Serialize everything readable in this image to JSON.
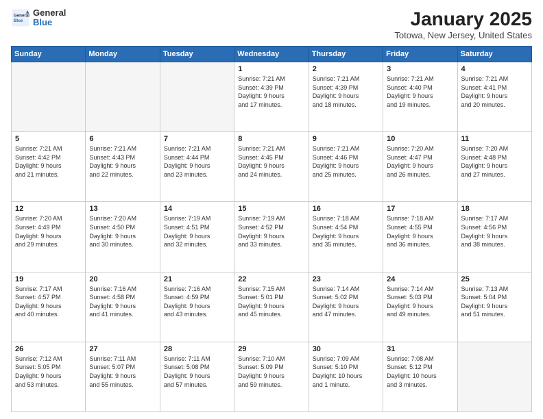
{
  "header": {
    "logo_general": "General",
    "logo_blue": "Blue",
    "month_title": "January 2025",
    "location": "Totowa, New Jersey, United States"
  },
  "days_of_week": [
    "Sunday",
    "Monday",
    "Tuesday",
    "Wednesday",
    "Thursday",
    "Friday",
    "Saturday"
  ],
  "weeks": [
    [
      {
        "day": "",
        "content": ""
      },
      {
        "day": "",
        "content": ""
      },
      {
        "day": "",
        "content": ""
      },
      {
        "day": "1",
        "content": "Sunrise: 7:21 AM\nSunset: 4:39 PM\nDaylight: 9 hours\nand 17 minutes."
      },
      {
        "day": "2",
        "content": "Sunrise: 7:21 AM\nSunset: 4:39 PM\nDaylight: 9 hours\nand 18 minutes."
      },
      {
        "day": "3",
        "content": "Sunrise: 7:21 AM\nSunset: 4:40 PM\nDaylight: 9 hours\nand 19 minutes."
      },
      {
        "day": "4",
        "content": "Sunrise: 7:21 AM\nSunset: 4:41 PM\nDaylight: 9 hours\nand 20 minutes."
      }
    ],
    [
      {
        "day": "5",
        "content": "Sunrise: 7:21 AM\nSunset: 4:42 PM\nDaylight: 9 hours\nand 21 minutes."
      },
      {
        "day": "6",
        "content": "Sunrise: 7:21 AM\nSunset: 4:43 PM\nDaylight: 9 hours\nand 22 minutes."
      },
      {
        "day": "7",
        "content": "Sunrise: 7:21 AM\nSunset: 4:44 PM\nDaylight: 9 hours\nand 23 minutes."
      },
      {
        "day": "8",
        "content": "Sunrise: 7:21 AM\nSunset: 4:45 PM\nDaylight: 9 hours\nand 24 minutes."
      },
      {
        "day": "9",
        "content": "Sunrise: 7:21 AM\nSunset: 4:46 PM\nDaylight: 9 hours\nand 25 minutes."
      },
      {
        "day": "10",
        "content": "Sunrise: 7:20 AM\nSunset: 4:47 PM\nDaylight: 9 hours\nand 26 minutes."
      },
      {
        "day": "11",
        "content": "Sunrise: 7:20 AM\nSunset: 4:48 PM\nDaylight: 9 hours\nand 27 minutes."
      }
    ],
    [
      {
        "day": "12",
        "content": "Sunrise: 7:20 AM\nSunset: 4:49 PM\nDaylight: 9 hours\nand 29 minutes."
      },
      {
        "day": "13",
        "content": "Sunrise: 7:20 AM\nSunset: 4:50 PM\nDaylight: 9 hours\nand 30 minutes."
      },
      {
        "day": "14",
        "content": "Sunrise: 7:19 AM\nSunset: 4:51 PM\nDaylight: 9 hours\nand 32 minutes."
      },
      {
        "day": "15",
        "content": "Sunrise: 7:19 AM\nSunset: 4:52 PM\nDaylight: 9 hours\nand 33 minutes."
      },
      {
        "day": "16",
        "content": "Sunrise: 7:18 AM\nSunset: 4:54 PM\nDaylight: 9 hours\nand 35 minutes."
      },
      {
        "day": "17",
        "content": "Sunrise: 7:18 AM\nSunset: 4:55 PM\nDaylight: 9 hours\nand 36 minutes."
      },
      {
        "day": "18",
        "content": "Sunrise: 7:17 AM\nSunset: 4:56 PM\nDaylight: 9 hours\nand 38 minutes."
      }
    ],
    [
      {
        "day": "19",
        "content": "Sunrise: 7:17 AM\nSunset: 4:57 PM\nDaylight: 9 hours\nand 40 minutes."
      },
      {
        "day": "20",
        "content": "Sunrise: 7:16 AM\nSunset: 4:58 PM\nDaylight: 9 hours\nand 41 minutes."
      },
      {
        "day": "21",
        "content": "Sunrise: 7:16 AM\nSunset: 4:59 PM\nDaylight: 9 hours\nand 43 minutes."
      },
      {
        "day": "22",
        "content": "Sunrise: 7:15 AM\nSunset: 5:01 PM\nDaylight: 9 hours\nand 45 minutes."
      },
      {
        "day": "23",
        "content": "Sunrise: 7:14 AM\nSunset: 5:02 PM\nDaylight: 9 hours\nand 47 minutes."
      },
      {
        "day": "24",
        "content": "Sunrise: 7:14 AM\nSunset: 5:03 PM\nDaylight: 9 hours\nand 49 minutes."
      },
      {
        "day": "25",
        "content": "Sunrise: 7:13 AM\nSunset: 5:04 PM\nDaylight: 9 hours\nand 51 minutes."
      }
    ],
    [
      {
        "day": "26",
        "content": "Sunrise: 7:12 AM\nSunset: 5:05 PM\nDaylight: 9 hours\nand 53 minutes."
      },
      {
        "day": "27",
        "content": "Sunrise: 7:11 AM\nSunset: 5:07 PM\nDaylight: 9 hours\nand 55 minutes."
      },
      {
        "day": "28",
        "content": "Sunrise: 7:11 AM\nSunset: 5:08 PM\nDaylight: 9 hours\nand 57 minutes."
      },
      {
        "day": "29",
        "content": "Sunrise: 7:10 AM\nSunset: 5:09 PM\nDaylight: 9 hours\nand 59 minutes."
      },
      {
        "day": "30",
        "content": "Sunrise: 7:09 AM\nSunset: 5:10 PM\nDaylight: 10 hours\nand 1 minute."
      },
      {
        "day": "31",
        "content": "Sunrise: 7:08 AM\nSunset: 5:12 PM\nDaylight: 10 hours\nand 3 minutes."
      },
      {
        "day": "",
        "content": ""
      }
    ]
  ]
}
